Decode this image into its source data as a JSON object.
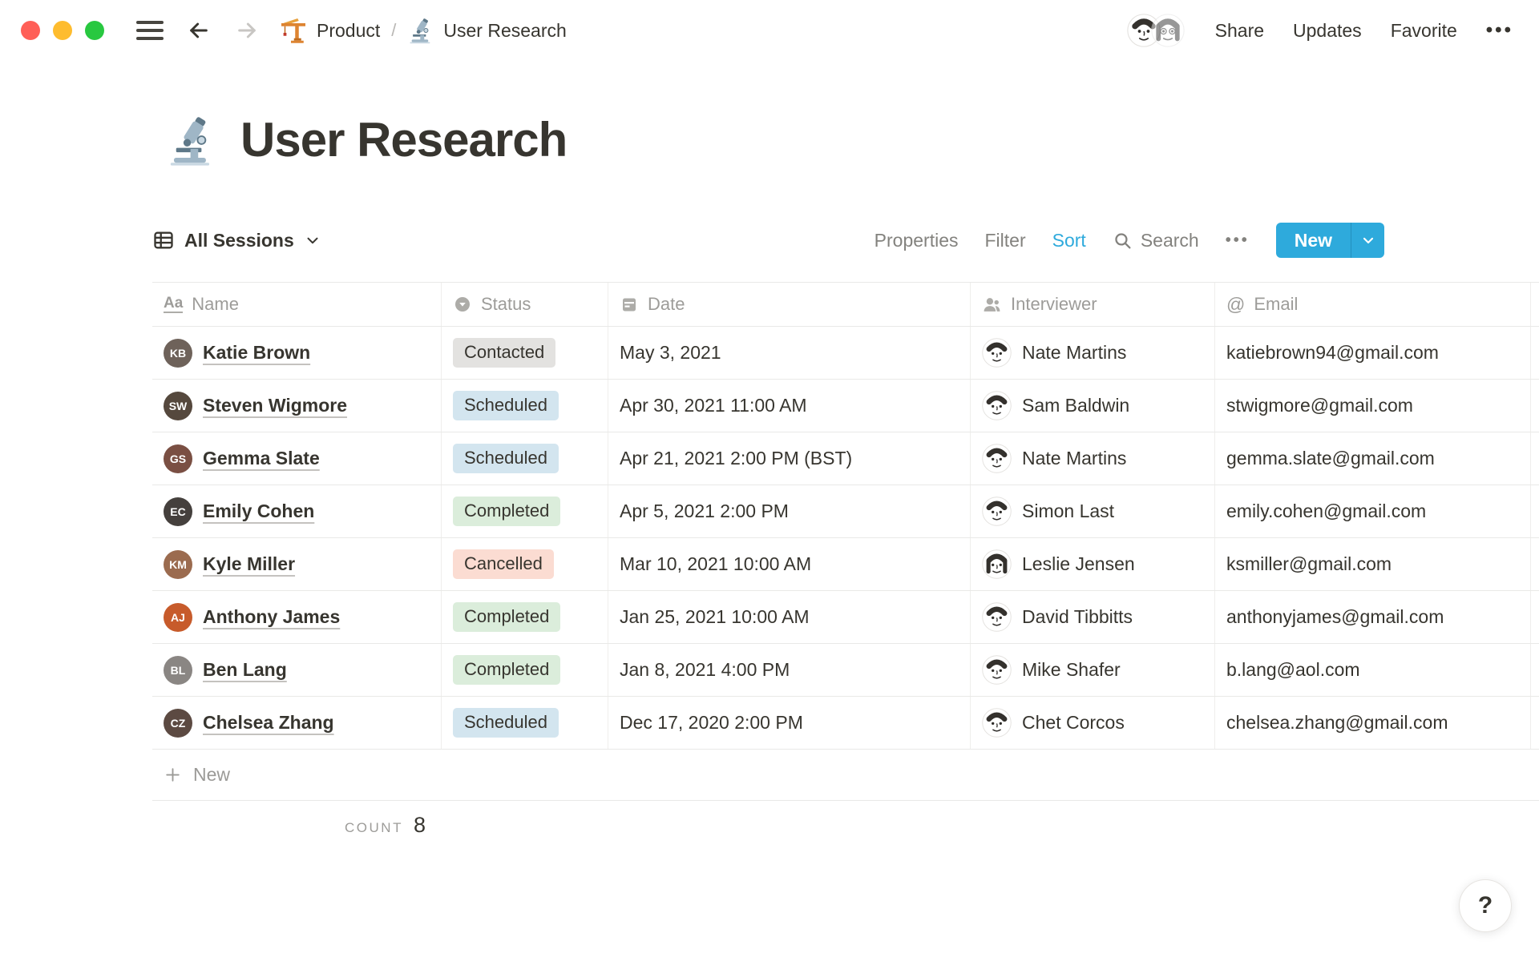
{
  "topbar": {
    "breadcrumb": {
      "items": [
        {
          "icon": "crane-icon",
          "label": "Product"
        },
        {
          "icon": "microscope-icon",
          "label": "User Research"
        }
      ],
      "separator": "/"
    },
    "share_label": "Share",
    "updates_label": "Updates",
    "favorite_label": "Favorite",
    "more_label": "•••"
  },
  "page": {
    "title": "User Research",
    "title_icon": "microscope-icon"
  },
  "toolbar": {
    "view_label": "All Sessions",
    "properties_label": "Properties",
    "filter_label": "Filter",
    "sort_label": "Sort",
    "search_label": "Search",
    "more_label": "•••",
    "new_label": "New"
  },
  "table": {
    "columns": [
      {
        "label": "Name",
        "icon": "text-icon"
      },
      {
        "label": "Status",
        "icon": "select-icon"
      },
      {
        "label": "Date",
        "icon": "calendar-icon"
      },
      {
        "label": "Interviewer",
        "icon": "person-icon"
      },
      {
        "label": "Email",
        "icon": "at-icon"
      }
    ],
    "rows": [
      {
        "name": "Katie Brown",
        "initials": "KB",
        "avatar_color": "#6E625A",
        "status": "Contacted",
        "status_color": "gray",
        "date": "May 3, 2021",
        "interviewer": "Nate Martins",
        "interviewer_variant": "male",
        "email": "katiebrown94@gmail.com"
      },
      {
        "name": "Steven Wigmore",
        "initials": "SW",
        "avatar_color": "#55483D",
        "status": "Scheduled",
        "status_color": "blue",
        "date": "Apr 30, 2021 11:00 AM",
        "interviewer": "Sam Baldwin",
        "interviewer_variant": "male",
        "email": "stwigmore@gmail.com"
      },
      {
        "name": "Gemma Slate",
        "initials": "GS",
        "avatar_color": "#7A4F43",
        "status": "Scheduled",
        "status_color": "blue",
        "date": "Apr 21, 2021 2:00 PM (BST)",
        "interviewer": "Nate Martins",
        "interviewer_variant": "male",
        "email": "gemma.slate@gmail.com"
      },
      {
        "name": "Emily Cohen",
        "initials": "EC",
        "avatar_color": "#45403D",
        "status": "Completed",
        "status_color": "green",
        "date": "Apr 5, 2021 2:00 PM",
        "interviewer": "Simon Last",
        "interviewer_variant": "male",
        "email": "emily.cohen@gmail.com"
      },
      {
        "name": "Kyle Miller",
        "initials": "KM",
        "avatar_color": "#9B6B4F",
        "status": "Cancelled",
        "status_color": "red",
        "date": "Mar 10, 2021 10:00 AM",
        "interviewer": "Leslie Jensen",
        "interviewer_variant": "female",
        "email": "ksmiller@gmail.com"
      },
      {
        "name": "Anthony James",
        "initials": "AJ",
        "avatar_color": "#C75B2B",
        "status": "Completed",
        "status_color": "green",
        "date": "Jan 25, 2021 10:00 AM",
        "interviewer": "David Tibbitts",
        "interviewer_variant": "male",
        "email": "anthonyjames@gmail.com"
      },
      {
        "name": "Ben Lang",
        "initials": "BL",
        "avatar_color": "#8A8683",
        "status": "Completed",
        "status_color": "green",
        "date": "Jan 8, 2021 4:00 PM",
        "interviewer": "Mike Shafer",
        "interviewer_variant": "male",
        "email": "b.lang@aol.com"
      },
      {
        "name": "Chelsea Zhang",
        "initials": "CZ",
        "avatar_color": "#5C4A42",
        "status": "Scheduled",
        "status_color": "blue",
        "date": "Dec 17, 2020 2:00 PM",
        "interviewer": "Chet Corcos",
        "interviewer_variant": "male",
        "email": "chelsea.zhang@gmail.com"
      }
    ],
    "new_row_label": "New",
    "footer": {
      "count_label": "COUNT",
      "count_value": "8"
    }
  },
  "help_label": "?",
  "colors": {
    "accent_blue": "#2EAADC",
    "badge_bg": {
      "gray": "#E3E2E0",
      "blue": "#D3E5EF",
      "green": "#DBEDDB",
      "red": "#FBDCD2"
    },
    "traffic": {
      "red": "#FF5F57",
      "yellow": "#FEBC2E",
      "green": "#28C840"
    }
  }
}
